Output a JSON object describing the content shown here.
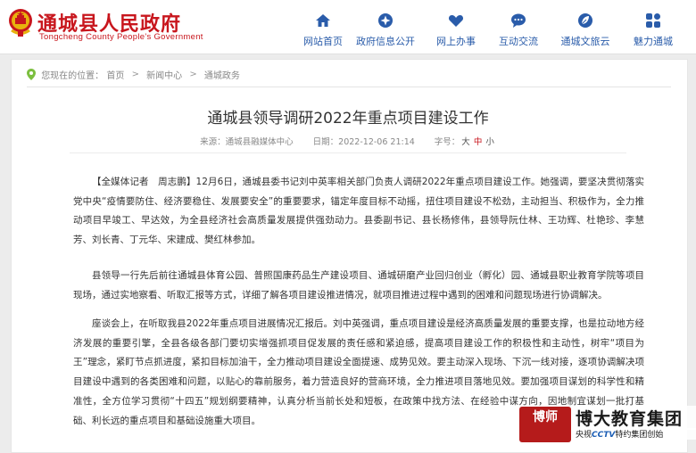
{
  "header": {
    "title": "通城县人民政府",
    "subtitle": "Tongcheng County People's Government",
    "nav": [
      {
        "label": "网站首页",
        "icon": "home-icon"
      },
      {
        "label": "政府信息公开",
        "icon": "compass-icon"
      },
      {
        "label": "网上办事",
        "icon": "heart-icon"
      },
      {
        "label": "互动交流",
        "icon": "chat-icon"
      },
      {
        "label": "通城文旅云",
        "icon": "leaf-icon"
      },
      {
        "label": "魅力通城",
        "icon": "grid-icon"
      }
    ],
    "accent_color": "#c8161d",
    "nav_color": "#2a5caa"
  },
  "breadcrumb": {
    "prefix": "您现在的位置：",
    "items": [
      "首页",
      "新闻中心",
      "通城政务"
    ],
    "separator": ">"
  },
  "article": {
    "title": "通城县领导调研2022年重点项目建设工作",
    "source": "来源：通城县融媒体中心",
    "date": "日期：2022-12-06 21:14",
    "font_size_label": "字号：",
    "font_sizes": [
      "大",
      "中",
      "小"
    ],
    "paragraphs": [
      "【全媒体记者　周志鹏】12月6日，通城县委书记刘中英率相关部门负责人调研2022年重点项目建设工作。她强调，要坚决贯彻落实党中央“疫情要防住、经济要稳住、发展要安全”的重要要求，锚定年度目标不动摇，扭住项目建设不松劲，主动担当、积极作为，全力推动项目早竣工、早达效，为全县经济社会高质量发展提供强劲动力。县委副书记、县长杨修伟，县领导阮仕林、王功辉、杜艳珍、李慧芳、刘长青、丁元华、宋建成、樊红林参加。",
      "县领导一行先后前往通城县体育公园、普照国康药品生产建设项目、通城研磨产业回归创业（孵化）园、通城县职业教育学院等项目现场，通过实地察看、听取汇报等方式，详细了解各项目建设推进情况，就项目推进过程中遇到的困难和问题现场进行协调解决。",
      "座谈会上，在听取我县2022年重点项目进展情况汇报后。刘中英强调，重点项目建设是经济高质量发展的重要支撑，也是拉动地方经济发展的重要引擎，全县各级各部门要切实增强抓项目促发展的责任感和紧迫感，提高项目建设工作的积极性和主动性，树牢“项目为王”理念，紧盯节点抓进度，紧扣目标加油干，全力推动项目建设全面提速、成势见效。要主动深入现场、下沉一线对接，逐项协调解决项目建设中遇到的各类困难和问题，以贴心的靠前服务，着力营造良好的营商环境，全力推进项目落地见效。要加强项目谋划的科学性和精准性，全方位学习贯彻“十四五”规划纲要精神，认真分析当前长处和短板，在政策中找方法、在经验中谋方向，因地制宜谋划一批打基础、利长远的重点项目和基础设施重大项目。"
    ]
  },
  "watermark": {
    "seal": "博师",
    "name": "博大教育集团",
    "sub_prefix": "央视",
    "sub_brand": "CCTV",
    "sub_suffix": "特约集团创始"
  }
}
